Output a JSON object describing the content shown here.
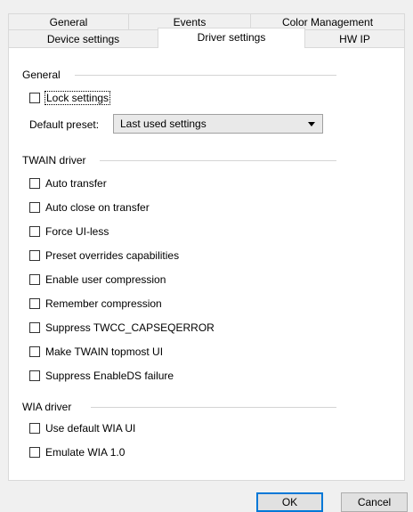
{
  "tabs_row1": [
    {
      "label": "General"
    },
    {
      "label": "Events"
    },
    {
      "label": "Color Management"
    }
  ],
  "tabs_row2": [
    {
      "label": "Device settings"
    },
    {
      "label": "Driver settings",
      "active": true
    },
    {
      "label": "HW IP"
    }
  ],
  "general": {
    "label": "General",
    "lock_settings": {
      "label": "Lock settings",
      "checked": false
    },
    "preset_label": "Default preset:",
    "preset_value": "Last used settings"
  },
  "twain": {
    "label": "TWAIN driver",
    "options": [
      {
        "label": "Auto transfer",
        "checked": false
      },
      {
        "label": "Auto close on transfer",
        "checked": false
      },
      {
        "label": "Force UI-less",
        "checked": false
      },
      {
        "label": "Preset overrides capabilities",
        "checked": false
      },
      {
        "label": "Enable user compression",
        "checked": false
      },
      {
        "label": "Remember compression",
        "checked": false
      },
      {
        "label": "Suppress TWCC_CAPSEQERROR",
        "checked": false
      },
      {
        "label": "Make TWAIN topmost UI",
        "checked": false
      },
      {
        "label": "Suppress EnableDS failure",
        "checked": false
      }
    ]
  },
  "wia": {
    "label": "WIA driver",
    "options": [
      {
        "label": "Use default WIA UI",
        "checked": false
      },
      {
        "label": "Emulate WIA 1.0",
        "checked": false
      }
    ]
  },
  "buttons": {
    "ok": "OK",
    "cancel": "Cancel"
  }
}
